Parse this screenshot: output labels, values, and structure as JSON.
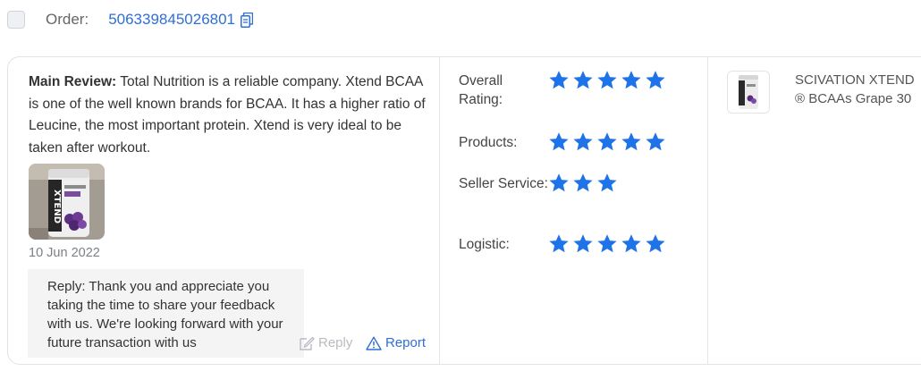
{
  "order": {
    "label": "Order:",
    "id": "506339845026801"
  },
  "review": {
    "label": "Main Review:",
    "text": " Total Nutrition is a reliable company. Xtend BCAA is one of the well known brands for BCAA. It has a higher ratio of Leucine, the most important protein. Xtend is very ideal to be taken after workout.",
    "photo_icon": "product-photo",
    "date": "10 Jun 2022",
    "reply_text": "Reply: Thank you and appreciate you taking the time to share your feedback with us. We're looking forward with your future transaction with us",
    "reply_button": "Reply",
    "report_button": "Report"
  },
  "ratings": [
    {
      "label": "Overall Rating:",
      "stars": 5
    },
    {
      "label": "Products:",
      "stars": 5
    },
    {
      "label": "Seller Service:",
      "stars": 3
    },
    {
      "label": "Logistic:",
      "stars": 5
    }
  ],
  "product": {
    "name_line1": "SCIVATION XTEND",
    "name_line2": "® BCAAs Grape 30"
  },
  "colors": {
    "accent": "#2f6fd6",
    "star": "#1f73e8"
  }
}
